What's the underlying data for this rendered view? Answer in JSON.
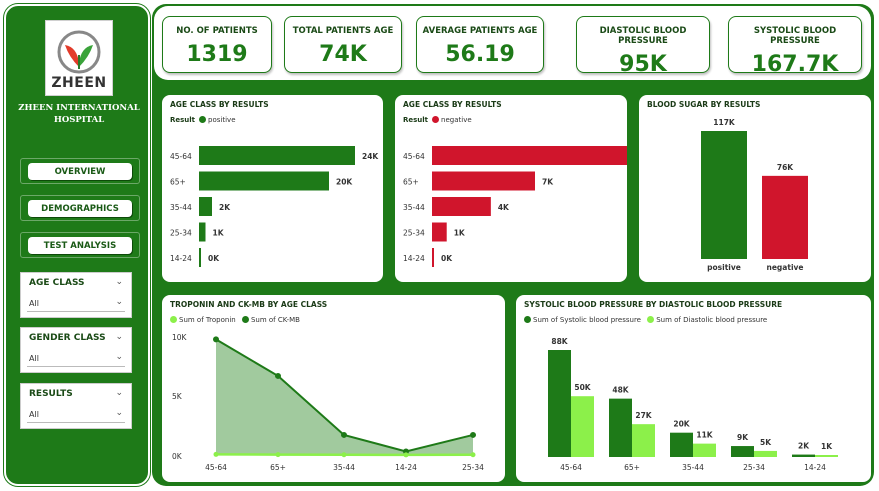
{
  "sidebar": {
    "logo_text": "ZHEEN",
    "hospital_name_line1": "ZHEEN INTERNATIONAL",
    "hospital_name_line2": "HOSPITAL",
    "nav": {
      "overview": "OVERVIEW",
      "demographics": "DEMOGRAPHICS",
      "test_analysis": "TEST ANALYSIS"
    },
    "slicers": [
      {
        "title": "AGE CLASS",
        "value": "All"
      },
      {
        "title": "GENDER CLASS",
        "value": "All"
      },
      {
        "title": "RESULTS",
        "value": "All"
      }
    ]
  },
  "kpis": [
    {
      "label": "NO. OF PATIENTS",
      "value": "1319"
    },
    {
      "label": "TOTAL PATIENTS AGE",
      "value": "74K"
    },
    {
      "label": "AVERAGE PATIENTS AGE",
      "value": "56.19"
    },
    {
      "label": "DIASTOLIC BLOOD PRESSURE",
      "value": "95K"
    },
    {
      "label": "SYSTOLIC BLOOD PRESSURE",
      "value": "167.7K"
    }
  ],
  "colors": {
    "green": "#1e7a18",
    "red": "#d0152c",
    "light_green": "#8cf04a",
    "area": "#9cc799"
  },
  "chart_data": [
    {
      "type": "bar",
      "title": "AGE CLASS BY RESULTS",
      "legend_title": "Result",
      "series": [
        {
          "name": "positive",
          "values": [
            24,
            20,
            2,
            1,
            0
          ]
        }
      ],
      "categories": [
        "45-64",
        "65+",
        "35-44",
        "25-34",
        "14-24"
      ],
      "labels": [
        "24K",
        "20K",
        "2K",
        "1K",
        "0K"
      ],
      "orientation": "horizontal"
    },
    {
      "type": "bar",
      "title": "AGE CLASS BY RESULTS",
      "legend_title": "Result",
      "series": [
        {
          "name": "negative",
          "values": [
            14,
            7,
            4,
            1,
            0
          ]
        }
      ],
      "categories": [
        "45-64",
        "65+",
        "35-44",
        "25-34",
        "14-24"
      ],
      "labels": [
        "14K",
        "7K",
        "4K",
        "1K",
        "0K"
      ],
      "orientation": "horizontal"
    },
    {
      "type": "bar",
      "title": "BLOOD SUGAR BY RESULTS",
      "categories": [
        "positive",
        "negative"
      ],
      "values": [
        117,
        76
      ],
      "labels": [
        "117K",
        "76K"
      ]
    },
    {
      "type": "area",
      "title": "TROPONIN AND CK-MB BY AGE CLASS",
      "categories": [
        "45-64",
        "65+",
        "35-44",
        "14-24",
        "25-34"
      ],
      "series": [
        {
          "name": "Sum of Troponin",
          "values": [
            0.05,
            0.03,
            0.02,
            0.01,
            0.02
          ]
        },
        {
          "name": "Sum of CK-MB",
          "values": [
            9.8,
            6.7,
            1.7,
            0.3,
            1.7
          ]
        }
      ],
      "y_ticks": [
        "10K",
        "5K",
        "0K"
      ],
      "ylim": [
        0,
        10
      ]
    },
    {
      "type": "bar",
      "title": "SYSTOLIC BLOOD PRESSURE BY DIASTOLIC BLOOD PRESSURE",
      "categories": [
        "45-64",
        "65+",
        "35-44",
        "25-34",
        "14-24"
      ],
      "series": [
        {
          "name": "Sum of Systolic blood pressure",
          "values": [
            88,
            48,
            20,
            9,
            2
          ],
          "labels": [
            "88K",
            "48K",
            "20K",
            "9K",
            "2K"
          ]
        },
        {
          "name": "Sum of Diastolic blood pressure",
          "values": [
            50,
            27,
            11,
            5,
            1
          ],
          "labels": [
            "50K",
            "27K",
            "11K",
            "5K",
            "1K"
          ]
        }
      ]
    }
  ]
}
